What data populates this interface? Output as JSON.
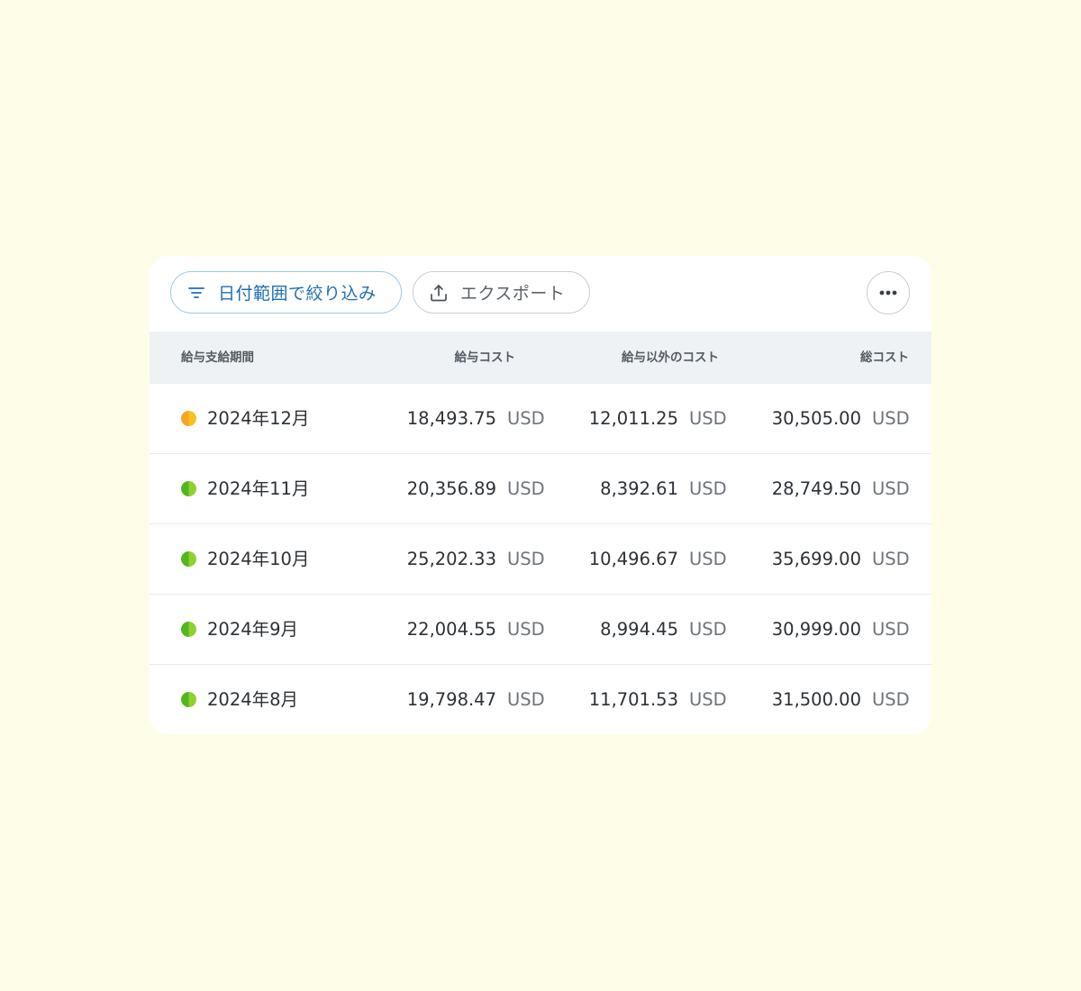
{
  "toolbar": {
    "filter_label": "日付範囲で絞り込み",
    "filter_icon": "filter-icon",
    "export_label": "エクスポート",
    "export_icon": "upload-icon",
    "more_icon": "more-horizontal-icon"
  },
  "table": {
    "headers": {
      "period": "給与支給期間",
      "payroll_cost": "給与コスト",
      "non_payroll_cost": "給与以外のコスト",
      "total_cost": "総コスト"
    },
    "rows": [
      {
        "period": "2024年12月",
        "status": "pending",
        "status_colors": [
          "#f5a623",
          "#f7c21e"
        ],
        "payroll_cost": "18,493.75",
        "payroll_currency": "USD",
        "non_payroll_cost": "12,011.25",
        "non_payroll_currency": "USD",
        "total_cost": "30,505.00",
        "total_currency": "USD"
      },
      {
        "period": "2024年11月",
        "status": "complete",
        "status_colors": [
          "#52b61f",
          "#8fd12e"
        ],
        "payroll_cost": "20,356.89",
        "payroll_currency": "USD",
        "non_payroll_cost": "8,392.61",
        "non_payroll_currency": "USD",
        "total_cost": "28,749.50",
        "total_currency": "USD"
      },
      {
        "period": "2024年10月",
        "status": "complete",
        "status_colors": [
          "#52b61f",
          "#8fd12e"
        ],
        "payroll_cost": "25,202.33",
        "payroll_currency": "USD",
        "non_payroll_cost": "10,496.67",
        "non_payroll_currency": "USD",
        "total_cost": "35,699.00",
        "total_currency": "USD"
      },
      {
        "period": "2024年9月",
        "status": "complete",
        "status_colors": [
          "#52b61f",
          "#8fd12e"
        ],
        "payroll_cost": "22,004.55",
        "payroll_currency": "USD",
        "non_payroll_cost": "8,994.45",
        "non_payroll_currency": "USD",
        "total_cost": "30,999.00",
        "total_currency": "USD"
      },
      {
        "period": "2024年8月",
        "status": "complete",
        "status_colors": [
          "#52b61f",
          "#8fd12e"
        ],
        "payroll_cost": "19,798.47",
        "payroll_currency": "USD",
        "non_payroll_cost": "11,701.53",
        "non_payroll_currency": "USD",
        "total_cost": "31,500.00",
        "total_currency": "USD"
      }
    ]
  },
  "colors": {
    "page_background": "#fefee8",
    "filter_accent": "#1f6fb2",
    "header_background": "#eef2f5"
  }
}
